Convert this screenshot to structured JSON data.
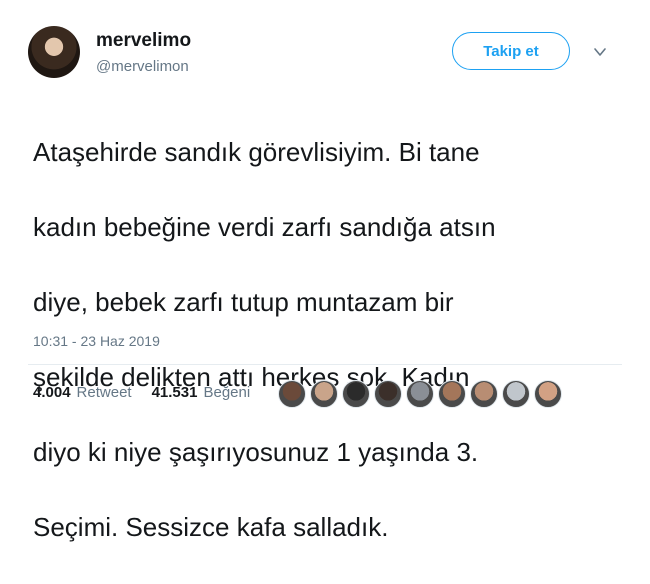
{
  "user": {
    "display_name": "mervelimo",
    "handle": "@mervelimon",
    "avatar": "profile-photo"
  },
  "follow_button": {
    "label": "Takip et"
  },
  "menu": {
    "icon": "chevron-down-icon"
  },
  "tweet": {
    "lines": [
      "Ataşehirde sandık görevlisiyim. Bi tane",
      "kadın bebeğine verdi zarfı sandığa atsın",
      "diye, bebek zarfı tutup muntazam bir",
      "şekilde delikten attı herkes şok. Kadın",
      "diyo ki niye şaşırıyosunuz 1 yaşında 3.",
      "Seçimi. Sessizce kafa salladık."
    ],
    "timestamp": "10:31 - 23 Haz 2019"
  },
  "stats": {
    "retweets_count": "4.004",
    "retweets_label": "Retweet",
    "likes_count": "41.531",
    "likes_label": "Beğeni"
  },
  "likers": [
    {
      "color": "#6b4a3a"
    },
    {
      "color": "#c9a48a"
    },
    {
      "color": "#2b2b2b"
    },
    {
      "color": "#3b2f2a"
    },
    {
      "color": "#8a8f96"
    },
    {
      "color": "#a4765a"
    },
    {
      "color": "#b88d73"
    },
    {
      "color": "#c0c6cc"
    },
    {
      "color": "#d2a184"
    }
  ],
  "colors": {
    "accent": "#1da1f2",
    "text": "#14171a",
    "muted": "#657786",
    "divider": "#e6ecf0"
  }
}
